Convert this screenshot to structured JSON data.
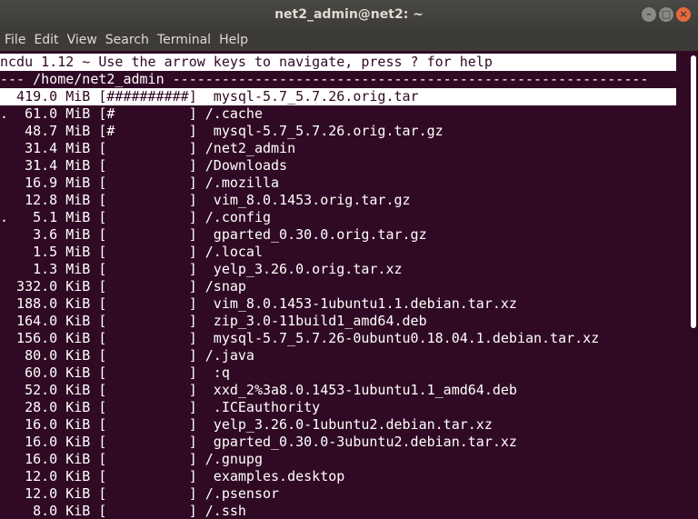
{
  "window": {
    "title": "net2_admin@net2: ~",
    "controls": {
      "minimize": "–",
      "maximize": "□",
      "close": "×"
    }
  },
  "menu": [
    "File",
    "Edit",
    "View",
    "Search",
    "Terminal",
    "Help"
  ],
  "ncdu": {
    "header": "ncdu 1.12 ~ Use the arrow keys to navigate, press ? for help",
    "path_line": "--- /home/net2_admin ----------------------------------------------------------",
    "rows": [
      "  419.0 MiB [##########]  mysql-5.7_5.7.26.orig.tar",
      ".  61.0 MiB [#         ] /.cache",
      "   48.7 MiB [#         ]  mysql-5.7_5.7.26.orig.tar.gz",
      "   31.4 MiB [          ] /net2_admin",
      "   31.4 MiB [          ] /Downloads",
      "   16.9 MiB [          ] /.mozilla",
      "   12.8 MiB [          ]  vim_8.0.1453.orig.tar.gz",
      ".   5.1 MiB [          ] /.config",
      "    3.6 MiB [          ]  gparted_0.30.0.orig.tar.gz",
      "    1.5 MiB [          ] /.local",
      "    1.3 MiB [          ]  yelp_3.26.0.orig.tar.xz",
      "  332.0 KiB [          ] /snap",
      "  188.0 KiB [          ]  vim_8.0.1453-1ubuntu1.1.debian.tar.xz",
      "  164.0 KiB [          ]  zip_3.0-11build1_amd64.deb",
      "  156.0 KiB [          ]  mysql-5.7_5.7.26-0ubuntu0.18.04.1.debian.tar.xz",
      "   80.0 KiB [          ] /.java",
      "   60.0 KiB [          ]  :q",
      "   52.0 KiB [          ]  xxd_2%3a8.0.1453-1ubuntu1.1_amd64.deb",
      "   28.0 KiB [          ]  .ICEauthority",
      "   16.0 KiB [          ]  yelp_3.26.0-1ubuntu2.debian.tar.xz",
      "   16.0 KiB [          ]  gparted_0.30.0-3ubuntu2.debian.tar.xz",
      "   16.0 KiB [          ] /.gnupg",
      "   12.0 KiB [          ]  examples.desktop",
      "   12.0 KiB [          ] /.psensor",
      "    8.0 KiB [          ] /.ssh"
    ]
  },
  "colors": {
    "terminal_bg": "#300a24",
    "terminal_fg": "#ffffff",
    "titlebar_bg": "#3c3b37",
    "close_button": "#e8673d"
  }
}
